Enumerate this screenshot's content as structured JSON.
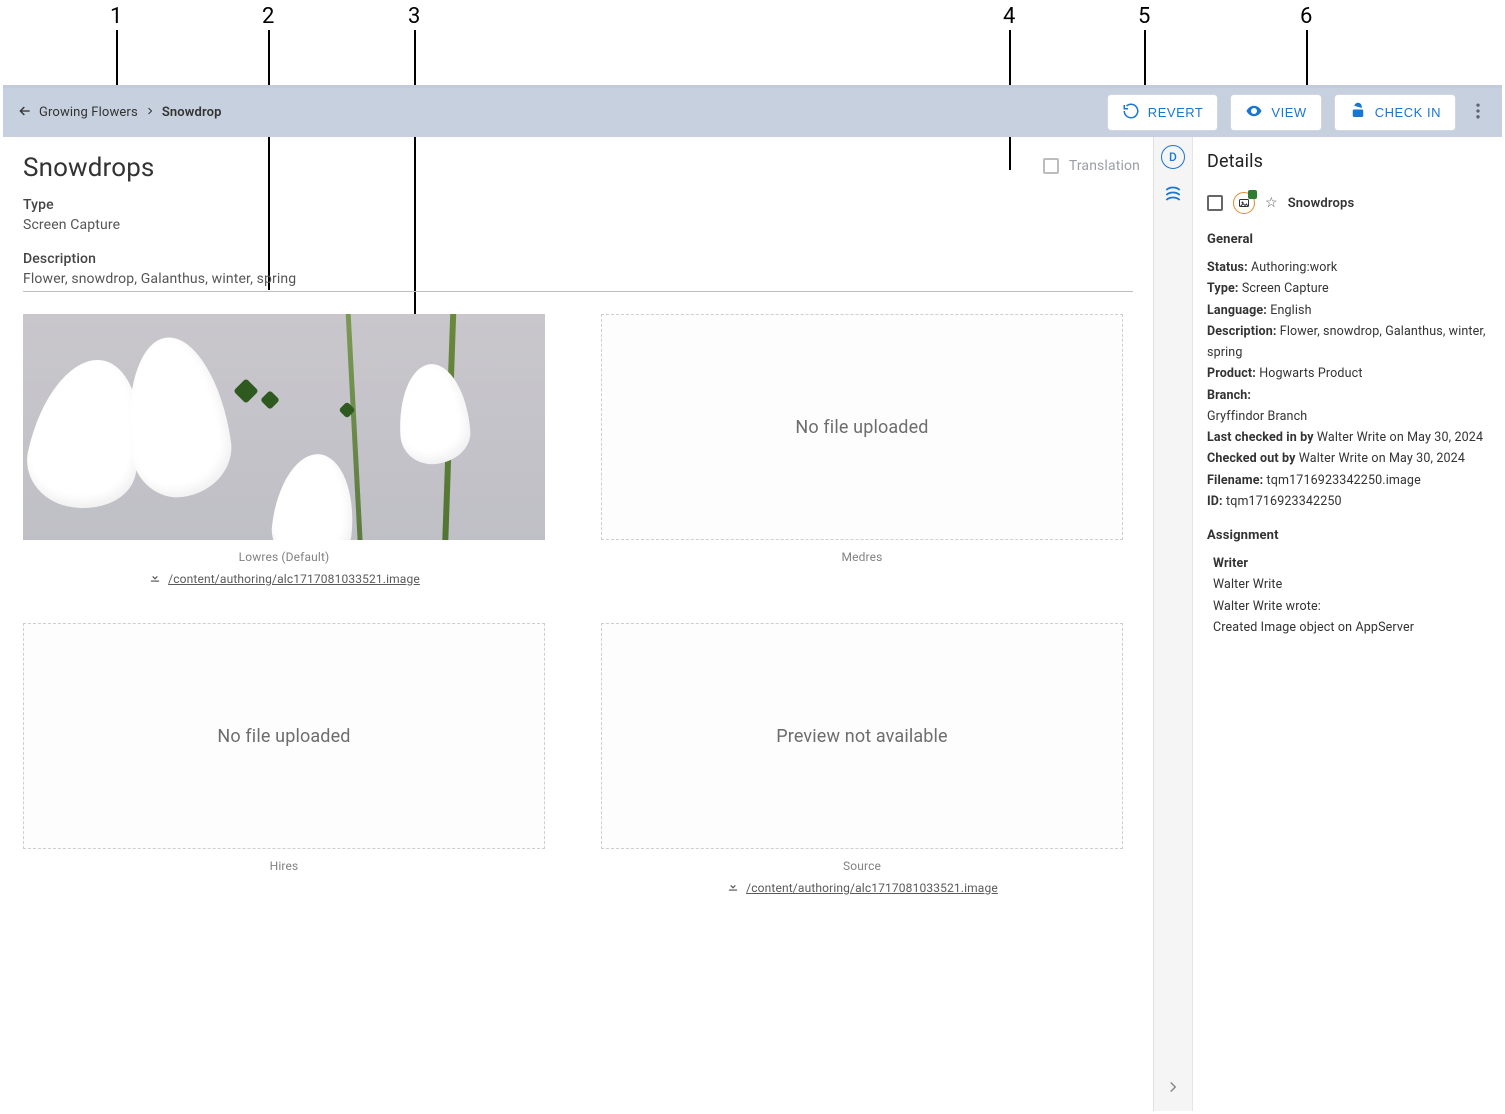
{
  "callouts": [
    "1",
    "2",
    "3",
    "4",
    "5",
    "6"
  ],
  "breadcrumb": {
    "parent": "Growing Flowers",
    "current": "Snowdrop"
  },
  "toolbar": {
    "revert": "REVERT",
    "view": "VIEW",
    "checkin": "CHECK IN"
  },
  "translation_label": "Translation",
  "main": {
    "title": "Snowdrops",
    "type_label": "Type",
    "type_value": "Screen Capture",
    "desc_label": "Description",
    "desc_value": "Flower, snowdrop, Galanthus, winter, spring"
  },
  "previews": {
    "lowres": {
      "label": "Lowres (Default)",
      "path": "/content/authoring/alc1717081033521.image"
    },
    "medres": {
      "label": "Medres",
      "empty": "No file uploaded"
    },
    "hires": {
      "label": "Hires",
      "empty": "No file uploaded"
    },
    "source": {
      "label": "Source",
      "empty": "Preview not available",
      "path": "/content/authoring/alc1717081033521.image"
    }
  },
  "details": {
    "heading": "Details",
    "item_name": "Snowdrops",
    "general_heading": "General",
    "status_label": "Status:",
    "status_value": "Authoring:work",
    "type_label": "Type:",
    "type_value": "Screen Capture",
    "language_label": "Language:",
    "language_value": "English",
    "description_label": "Description:",
    "description_value": "Flower, snowdrop, Galanthus, winter, spring",
    "product_label": "Product:",
    "product_value": "Hogwarts Product",
    "branch_label": "Branch:",
    "branch_value": "Gryffindor Branch",
    "lastcheckin_label": "Last checked in by",
    "lastcheckin_value": "Walter Write on May 30, 2024",
    "checkedout_label": "Checked out by",
    "checkedout_value": "Walter Write on May 30, 2024",
    "filename_label": "Filename:",
    "filename_value": "tqm1716923342250.image",
    "id_label": "ID:",
    "id_value": "tqm1716923342250",
    "assignment_heading": "Assignment",
    "writer_heading": "Writer",
    "writer_name": "Walter Write",
    "writer_wrote": "Walter Write wrote:",
    "writer_note": "Created Image object on AppServer"
  }
}
